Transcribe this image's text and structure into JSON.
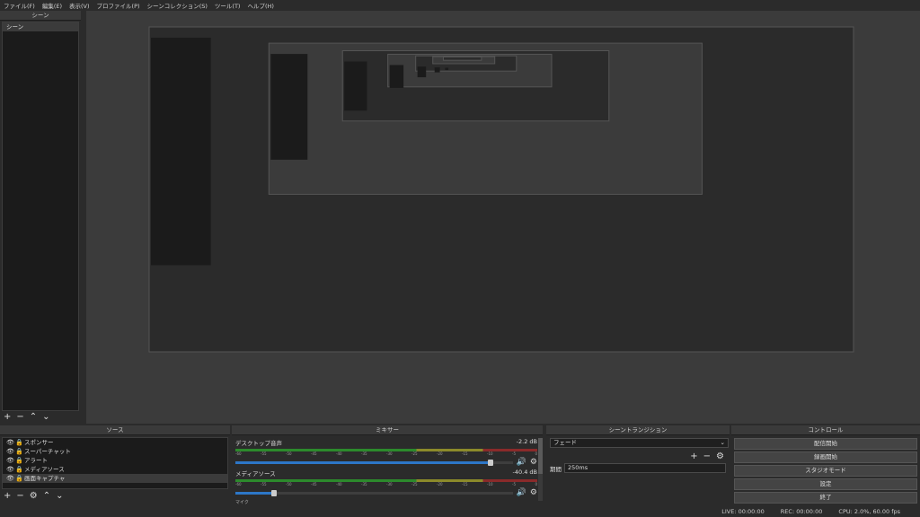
{
  "menu": [
    "ファイル(F)",
    "編集(E)",
    "表示(V)",
    "プロファイル(P)",
    "シーンコレクション(S)",
    "ツール(T)",
    "ヘルプ(H)"
  ],
  "scenes": {
    "title": "シーン",
    "items": [
      "シーン"
    ]
  },
  "sources": {
    "title": "ソース",
    "items": [
      {
        "label": "スポンサー"
      },
      {
        "label": "スーパーチャット"
      },
      {
        "label": "アラート"
      },
      {
        "label": "メディアソース"
      },
      {
        "label": "画面キャプチャ"
      }
    ]
  },
  "mixer": {
    "title": "ミキサー",
    "channels": [
      {
        "name": "デスクトップ音声",
        "db": "-2.2 dB",
        "volume": 0.92
      },
      {
        "name": "メディアソース",
        "db": "-40.4 dB",
        "volume": 0.14
      }
    ],
    "next_channel": "マイク",
    "ticks": [
      "-60",
      "-55",
      "-50",
      "-45",
      "-40",
      "-35",
      "-30",
      "-25",
      "-20",
      "-15",
      "-10",
      "-5",
      "0"
    ]
  },
  "transitions": {
    "title": "シーントランジション",
    "selected": "フェード",
    "duration_label": "期間",
    "duration_value": "250ms"
  },
  "controls": {
    "title": "コントロール",
    "buttons": [
      "配信開始",
      "録画開始",
      "スタジオモード",
      "設定",
      "終了"
    ]
  },
  "status": {
    "live": "LIVE: 00:00:00",
    "rec": "REC: 00:00:00",
    "cpu": "CPU: 2.0%, 60.00 fps"
  },
  "colors": {
    "accent": "#2d77c8",
    "meter_green": "#2c8a2c",
    "meter_yellow": "#8c8a2a",
    "meter_red": "#8a2a2a"
  }
}
